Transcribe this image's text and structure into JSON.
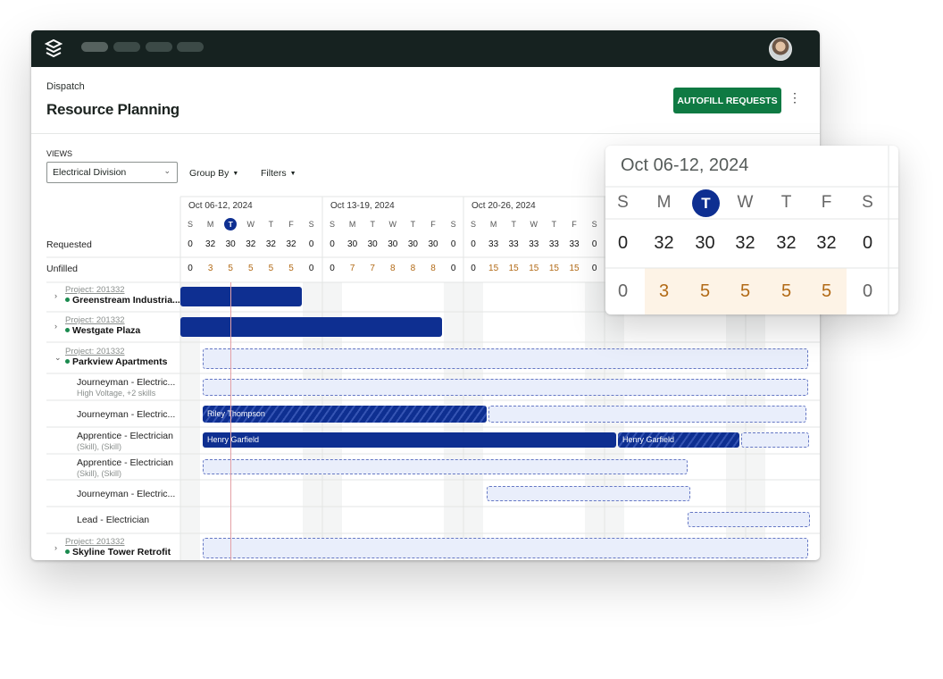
{
  "app": {
    "breadcrumb": "Dispatch",
    "page_title": "Resource Planning"
  },
  "toolbar": {
    "autofill_label": "AUTOFILL REQUESTS"
  },
  "views": {
    "label": "VIEWS",
    "selected": "Electrical Division"
  },
  "controls": {
    "group_by": "Group By",
    "filters": "Filters"
  },
  "colors": {
    "topbar": "#162220",
    "primary": "#0f7a43",
    "bar": "#0e2f91",
    "unfilled": "#b26a16"
  },
  "summary_rows": {
    "requested": "Requested",
    "unfilled": "Unfilled"
  },
  "weeks": [
    {
      "label": "Oct 06-12, 2024",
      "days": [
        "S",
        "M",
        "T",
        "W",
        "T",
        "F",
        "S"
      ],
      "requested": [
        "0",
        "32",
        "30",
        "32",
        "32",
        "32",
        "0"
      ],
      "unfilled": [
        "0",
        "3",
        "5",
        "5",
        "5",
        "5",
        "0"
      ]
    },
    {
      "label": "Oct 13-19, 2024",
      "days": [
        "S",
        "M",
        "T",
        "W",
        "T",
        "F",
        "S"
      ],
      "requested": [
        "0",
        "30",
        "30",
        "30",
        "30",
        "30",
        "0"
      ],
      "unfilled": [
        "0",
        "7",
        "7",
        "8",
        "8",
        "8",
        "0"
      ]
    },
    {
      "label": "Oct 20-26, 2024",
      "days": [
        "S",
        "M",
        "T",
        "W",
        "T",
        "F",
        "S"
      ],
      "requested": [
        "0",
        "33",
        "33",
        "33",
        "33",
        "33",
        "0"
      ],
      "unfilled": [
        "0",
        "15",
        "15",
        "15",
        "15",
        "15",
        "0"
      ]
    }
  ],
  "rows": {
    "p1": {
      "tag": "Project: 201332",
      "name": "Greenstream Industria..."
    },
    "p2": {
      "tag": "Project: 201332",
      "name": "Westgate Plaza"
    },
    "p3": {
      "tag": "Project: 201332",
      "name": "Parkview Apartments"
    },
    "r1": {
      "role": "Journeyman - Electric...",
      "sub": "High Voltage, +2 skills"
    },
    "r2": {
      "role": "Journeyman - Electric..."
    },
    "r3": {
      "role": "Apprentice - Electrician",
      "sub": "(Skill), (Skill)"
    },
    "r4": {
      "role": "Apprentice - Electrician",
      "sub": "(Skill), (Skill)"
    },
    "r5": {
      "role": "Journeyman - Electric..."
    },
    "r6": {
      "role": "Lead - Electrician"
    },
    "p4": {
      "tag": "Project: 201332",
      "name": "Skyline Tower Retrofit"
    }
  },
  "assignments": {
    "riley": "Riley Thompson",
    "henry1": "Henry Garfield",
    "henry2": "Henry Garfield"
  },
  "zoom": {
    "title": "Oct 06-12, 2024",
    "days": [
      "S",
      "M",
      "T",
      "W",
      "T",
      "F",
      "S"
    ],
    "requested": [
      "0",
      "32",
      "30",
      "32",
      "32",
      "32",
      "0"
    ],
    "unfilled": [
      "0",
      "3",
      "5",
      "5",
      "5",
      "5",
      "0"
    ]
  }
}
